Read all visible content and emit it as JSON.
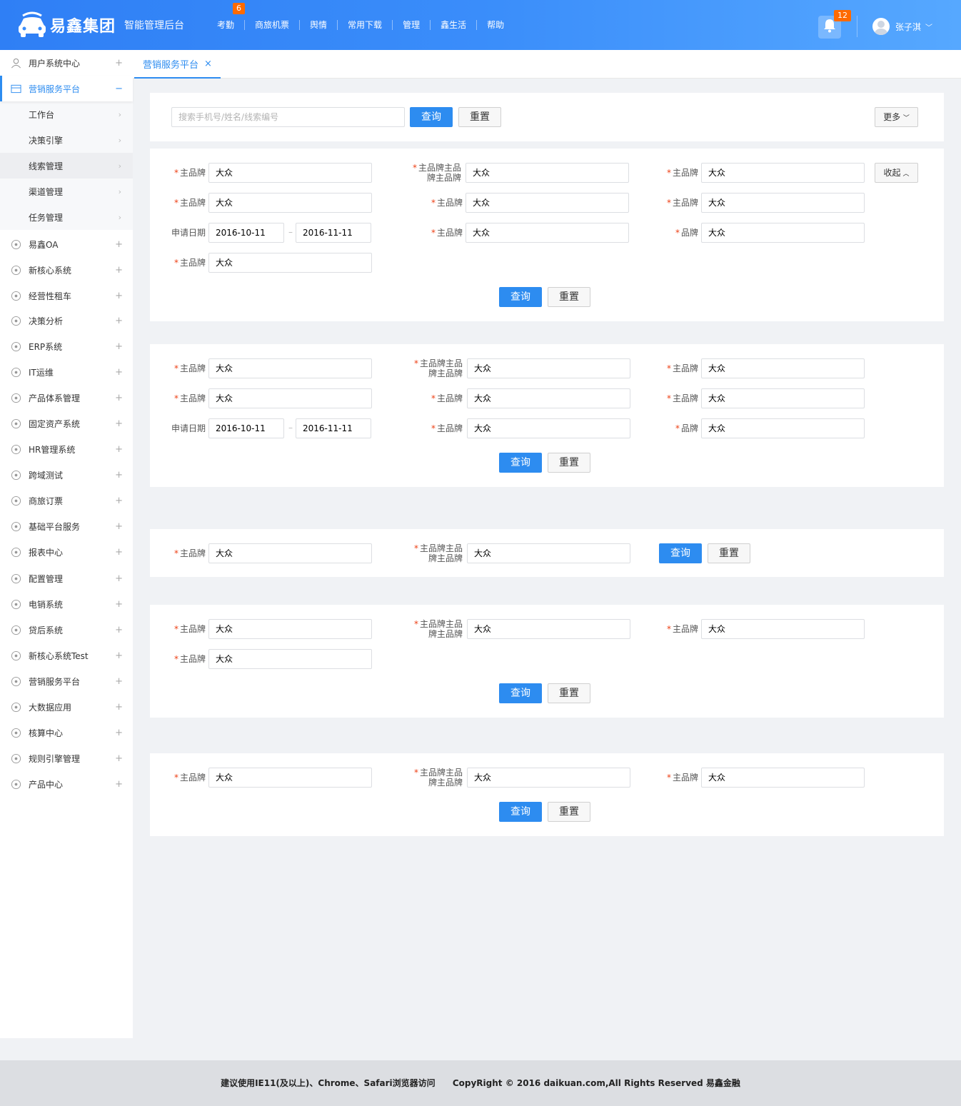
{
  "brand": {
    "name": "易鑫集团",
    "subtitle": "智能管理后台"
  },
  "topnav": [
    {
      "label": "考勤",
      "badge": "6"
    },
    {
      "label": "商旅机票"
    },
    {
      "label": "舆情"
    },
    {
      "label": "常用下载"
    },
    {
      "label": "管理"
    },
    {
      "label": "鑫生活"
    },
    {
      "label": "帮助"
    }
  ],
  "notifications": {
    "badge": "12"
  },
  "user": {
    "name": "张子淇"
  },
  "sidebar": {
    "top_items": [
      {
        "label": "用户系统中心",
        "toggle": "+",
        "icon": "user-icon"
      },
      {
        "label": "营销服务平台",
        "toggle": "−",
        "icon": "wallet-icon"
      }
    ],
    "sub_items": [
      "工作台",
      "决策引擎",
      "线索管理",
      "渠道管理",
      "任务管理"
    ],
    "items": [
      {
        "label": "易鑫OA",
        "icon": "org-icon"
      },
      {
        "label": "新核心系统",
        "icon": "yen-circle-icon"
      },
      {
        "label": "经营性租车",
        "icon": "car-icon"
      },
      {
        "label": "决策分析",
        "icon": "trend-icon"
      },
      {
        "label": "ERP系统",
        "icon": "yen-icon"
      },
      {
        "label": "IT运维",
        "icon": "it-icon"
      },
      {
        "label": "产品体系管理",
        "icon": "chart-icon"
      },
      {
        "label": "固定资产系统",
        "icon": "assets-icon"
      },
      {
        "label": "HR管理系统",
        "icon": "hr-icon"
      },
      {
        "label": "跨域测试",
        "icon": "location-icon"
      },
      {
        "label": "商旅订票",
        "icon": "ticket-icon"
      },
      {
        "label": "基础平台服务",
        "icon": "grid-icon"
      },
      {
        "label": "报表中心",
        "icon": "report-icon"
      },
      {
        "label": "配置管理",
        "icon": "settings-sliders-icon"
      },
      {
        "label": "电销系统",
        "icon": "phone-icon"
      },
      {
        "label": "贷后系统",
        "icon": "exchange-icon"
      },
      {
        "label": "新核心系统Test",
        "icon": "gear-icon"
      },
      {
        "label": "营销服务平台",
        "icon": "search-icon"
      },
      {
        "label": "大数据应用",
        "icon": "monitor-icon"
      },
      {
        "label": "核算中心",
        "icon": "calculator-icon"
      },
      {
        "label": "规则引擎管理",
        "icon": "rules-icon"
      },
      {
        "label": "产品中心",
        "icon": "list-icon"
      }
    ]
  },
  "tab": {
    "label": "营销服务平台",
    "close": "×"
  },
  "search_bar": {
    "placeholder": "搜索手机号/姓名/线索编号",
    "query": "查询",
    "reset": "重置",
    "more": "更多"
  },
  "form": {
    "brand_label": "主品牌",
    "long_label_1": "主品牌主品",
    "long_label_2": "牌主品牌",
    "date_label": "申请日期",
    "short_label": "品牌",
    "value": "大众",
    "date_start": "2016-10-11",
    "date_end": "2016-11-11",
    "date_sep": "–",
    "query": "查询",
    "reset": "重置",
    "collapse": "收起"
  },
  "footer": {
    "browser_tip": "建议使用IE11(及以上)、Chrome、Safari浏览器访问",
    "copyright": "CopyRight © 2016 daikuan.com,All Rights Reserved 易鑫金融"
  }
}
